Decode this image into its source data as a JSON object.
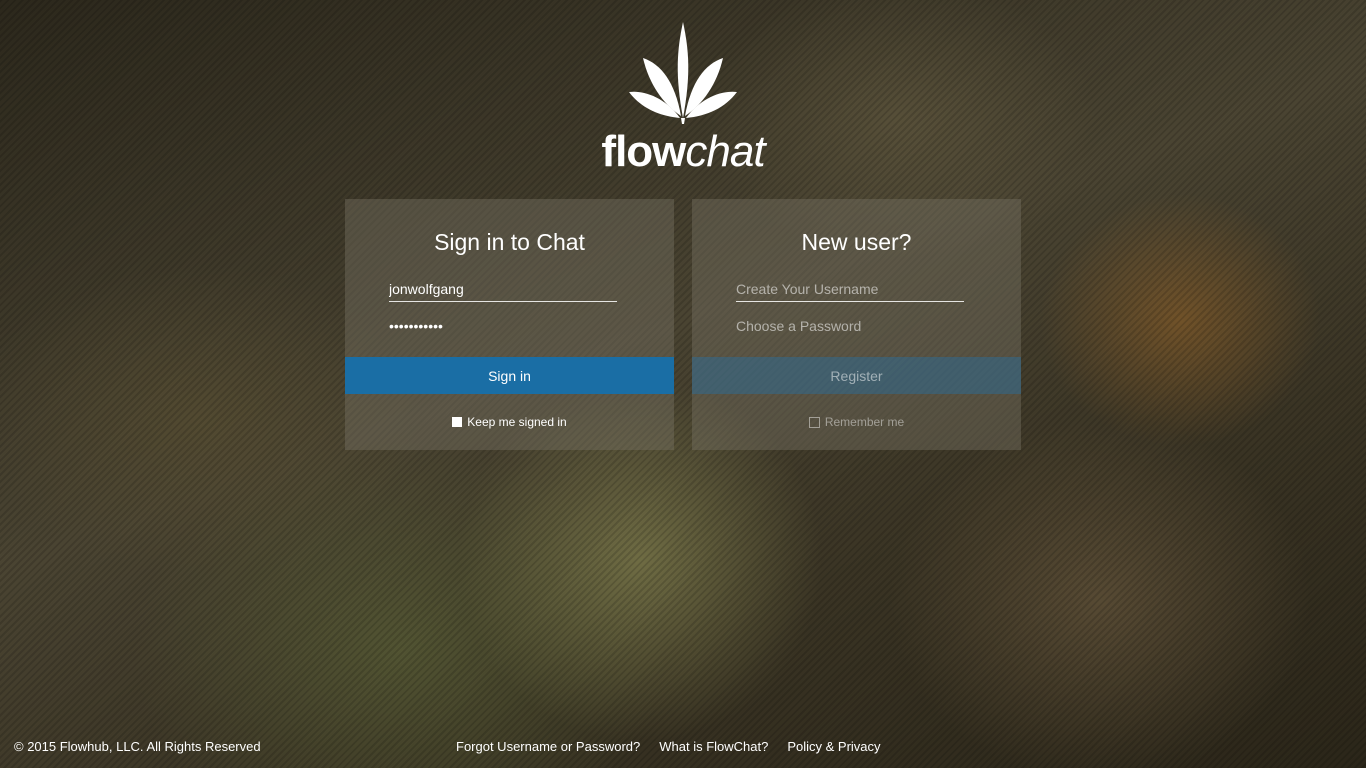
{
  "brand": {
    "name_bold": "flow",
    "name_italic": "chat",
    "logo_icon": "cannabis-leaf-icon"
  },
  "signin": {
    "title": "Sign in to Chat",
    "username_value": "jonwolfgang",
    "password_value": "•••••••••••",
    "button_label": "Sign in",
    "keep_signed_in_label": "Keep me signed in",
    "keep_signed_in_checked": true
  },
  "register": {
    "title": "New user?",
    "username_placeholder": "Create Your Username",
    "password_placeholder": "Choose a Password",
    "button_label": "Register",
    "remember_label": "Remember me",
    "remember_checked": false
  },
  "footer": {
    "copyright": "© 2015 Flowhub, LLC. All Rights Reserved",
    "links": [
      "Forgot Username or Password?",
      "What is FlowChat?",
      "Policy & Privacy"
    ]
  },
  "colors": {
    "primary_button": "#1a6ea5",
    "panel_bg": "rgba(120,115,100,0.42)"
  }
}
